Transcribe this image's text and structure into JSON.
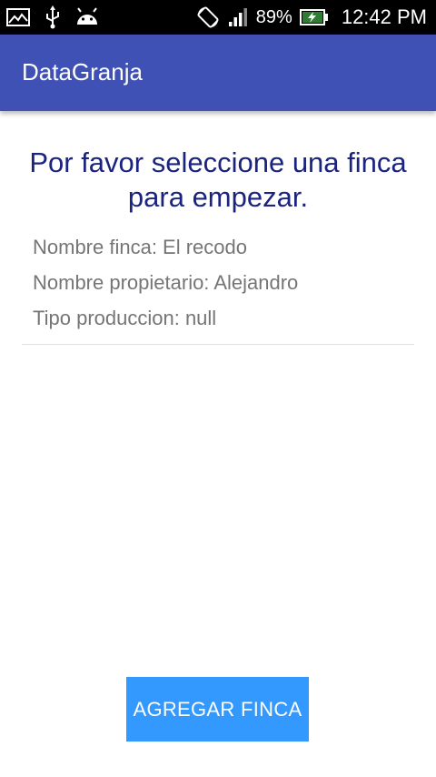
{
  "status_bar": {
    "icons_left": [
      "gallery-icon",
      "usb-icon",
      "android-icon"
    ],
    "icons_right": [
      "rotate-icon",
      "signal-icon",
      "battery-charging-icon"
    ],
    "battery": "89%",
    "time": "12:42 PM"
  },
  "app_bar": {
    "title": "DataGranja",
    "color": "#3f51b5"
  },
  "main": {
    "heading": "Por favor seleccione una finca para empezar.",
    "fincas": [
      {
        "nombre": "Nombre finca: El recodo",
        "propietario": "Nombre propietario: Alejandro",
        "tipo": "Tipo produccion: null"
      }
    ],
    "add_button_label": "AGREGAR FINCA",
    "add_button_color": "#3399ff"
  }
}
